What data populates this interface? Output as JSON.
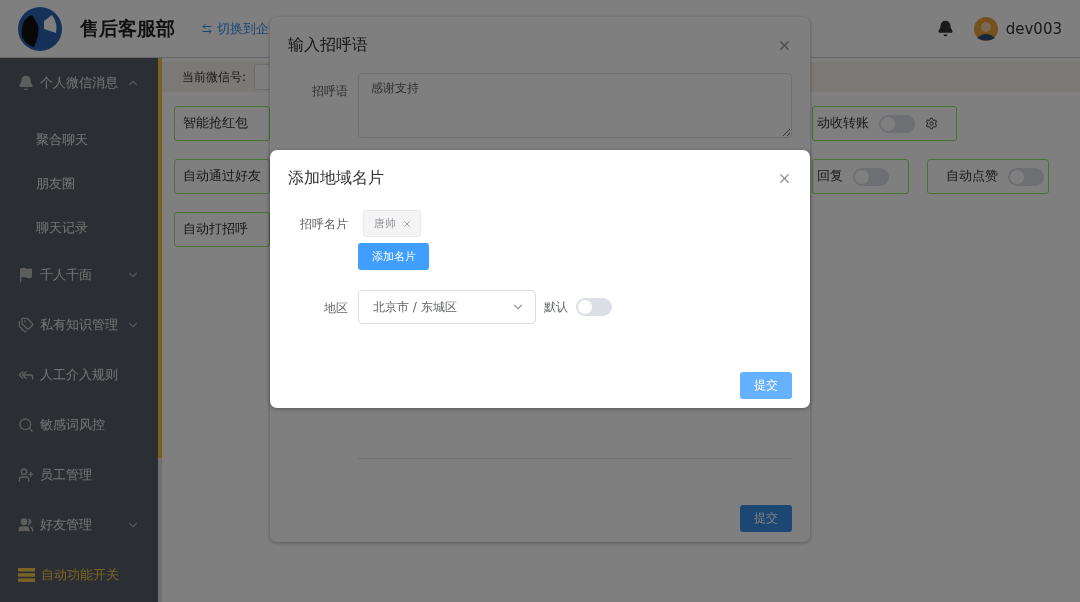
{
  "header": {
    "title": "售后客服部",
    "switch_link": "切换到企",
    "username": "dev003"
  },
  "sidebar": {
    "items": [
      {
        "label": "个人微信消息",
        "selected": false,
        "expanded": true,
        "children": [
          {
            "label": "聚合聊天",
            "selected": false
          },
          {
            "label": "朋友圈",
            "selected": false
          },
          {
            "label": "聊天记录",
            "selected": false
          }
        ]
      },
      {
        "label": "千人千面",
        "selected": false,
        "expanded": false
      },
      {
        "label": "私有知识管理",
        "selected": false,
        "expanded": false
      },
      {
        "label": "人工介入规则",
        "selected": false
      },
      {
        "label": "敏感词风控",
        "selected": false
      },
      {
        "label": "员工管理",
        "selected": false
      },
      {
        "label": "好友管理",
        "selected": false,
        "expanded": false
      },
      {
        "label": "自动功能开关",
        "selected": true
      }
    ]
  },
  "content": {
    "wechat_label": "当前微信号:",
    "rows": [
      {
        "left": {
          "label": "智能抢红包"
        },
        "right": [
          {
            "kind": "switch-settings",
            "label": "动收转账",
            "on": false
          }
        ]
      },
      {
        "left": {
          "label": "自动通过好友"
        },
        "right": [
          {
            "kind": "switch",
            "label": "回复",
            "on": false
          },
          {
            "kind": "switch",
            "label": "自动点赞",
            "on": false
          }
        ]
      },
      {
        "left": {
          "label": "自动打招呼"
        },
        "right": []
      }
    ]
  },
  "greeting_dialog": {
    "title": "输入招呼语",
    "field_label": "招呼语",
    "value": "感谢支持",
    "submit": "提交"
  },
  "card_dialog": {
    "title": "添加地域名片",
    "card_label": "招呼名片",
    "tags": [
      "唐帅"
    ],
    "add_button": "添加名片",
    "region_label": "地区",
    "region_value": "北京市 / 东城区",
    "default_label": "默认",
    "default_on": false,
    "submit": "提交"
  }
}
